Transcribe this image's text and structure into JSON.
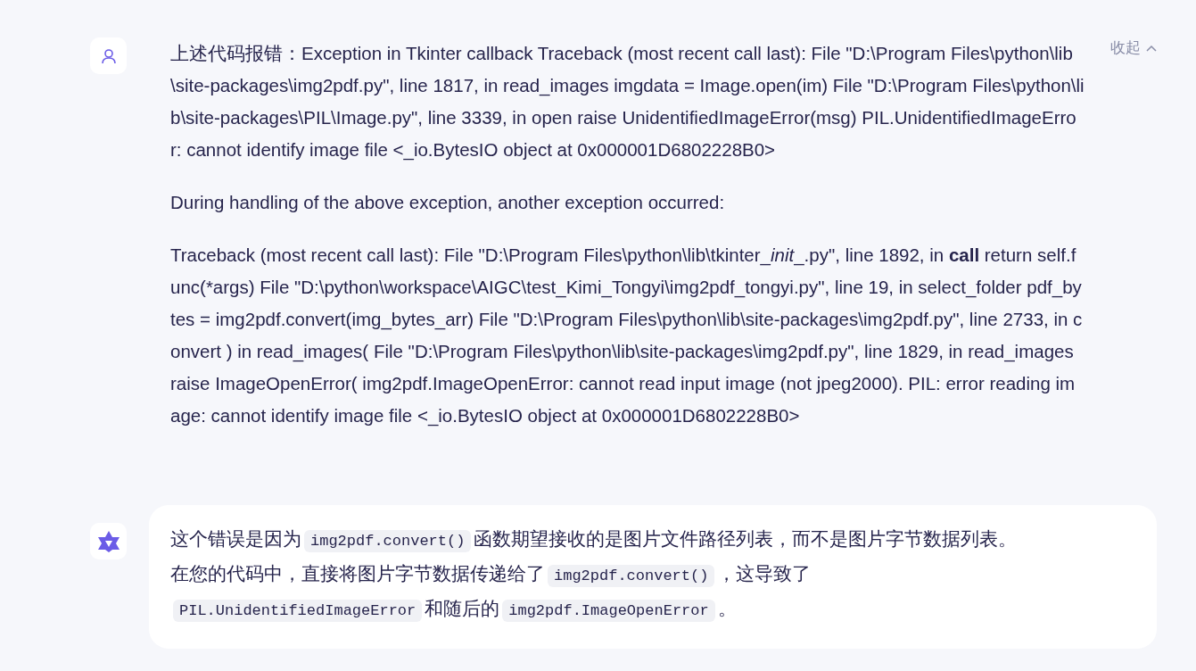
{
  "messages": [
    {
      "kind": "user",
      "collapse_label": "收起",
      "paragraphs": [
        "上述代码报错：Exception in Tkinter callback Traceback (most recent call last): File \"D:\\Program Files\\python\\lib\\site-packages\\img2pdf.py\", line 1817, in read_images imgdata = Image.open(im) File \"D:\\Program Files\\python\\lib\\site-packages\\PIL\\Image.py\", line 3339, in open raise UnidentifiedImageError(msg) PIL.UnidentifiedImageError: cannot identify image file <_io.BytesIO object at 0x000001D6802228B0>",
        "During handling of the above exception, another exception occurred:",
        [
          {
            "kind": "text",
            "text": "Traceback (most recent call last): File \"D:\\Program Files\\python\\lib\\tkinter_"
          },
          {
            "kind": "italic",
            "text": "init"
          },
          {
            "kind": "text",
            "text": "_.py\", line 1892, in "
          },
          {
            "kind": "bold",
            "text": "call"
          },
          {
            "kind": "text",
            "text": " return self.func(*args) File \"D:\\python\\workspace\\AIGC\\test_Kimi_Tongyi\\img2pdf_tongyi.py\", line 19, in select_folder pdf_bytes = img2pdf.convert(img_bytes_arr) File \"D:\\Program Files\\python\\lib\\site-packages\\img2pdf.py\", line 2733, in convert ) in read_images( File \"D:\\Program Files\\python\\lib\\site-packages\\img2pdf.py\", line 1829, in read_images raise ImageOpenError( img2pdf.ImageOpenError: cannot read input image (not jpeg2000). PIL: error reading image: cannot identify image file <_io.BytesIO object at 0x000001D6802228B0>"
          }
        ]
      ]
    },
    {
      "kind": "assistant",
      "segments": [
        {
          "kind": "text",
          "text": "这个错误是因为"
        },
        {
          "kind": "code",
          "text": "img2pdf.convert()"
        },
        {
          "kind": "text",
          "text": "函数期望接收的是图片文件路径列表，而不是图片字节数据列表。"
        },
        {
          "kind": "break"
        },
        {
          "kind": "text",
          "text": "在您的代码中，直接将图片字节数据传递给了"
        },
        {
          "kind": "code",
          "text": "img2pdf.convert()"
        },
        {
          "kind": "text",
          "text": "，这导致了"
        },
        {
          "kind": "break"
        },
        {
          "kind": "code",
          "text": "PIL.UnidentifiedImageError"
        },
        {
          "kind": "text",
          "text": "和随后的"
        },
        {
          "kind": "code",
          "text": "img2pdf.ImageOpenError"
        },
        {
          "kind": "text",
          "text": "。"
        }
      ]
    }
  ]
}
